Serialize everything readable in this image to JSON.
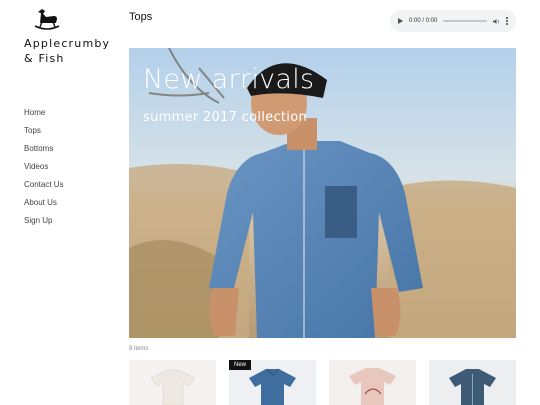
{
  "brand": {
    "name": "Applecrumby & Fish",
    "logo_icon": "rocking-horse-icon"
  },
  "nav": {
    "items": [
      {
        "label": "Home"
      },
      {
        "label": "Tops"
      },
      {
        "label": "Bottoms"
      },
      {
        "label": "Videos"
      },
      {
        "label": "Contact Us"
      },
      {
        "label": "About Us"
      },
      {
        "label": "Sign Up"
      }
    ]
  },
  "header": {
    "title": "Tops"
  },
  "audio": {
    "time": "0:00 / 0:00",
    "play_icon": "play-icon",
    "volume_icon": "volume-icon",
    "menu_icon": "more-vertical-icon"
  },
  "hero": {
    "title": "New arrivals",
    "subtitle": "summer 2017 collection"
  },
  "catalog": {
    "count_label": "8 items",
    "products": [
      {
        "badge": "",
        "shirt_color": "#f2efe9"
      },
      {
        "badge": "New",
        "shirt_color": "#3f6e9e"
      },
      {
        "badge": "",
        "shirt_color": "#e8c8bd"
      },
      {
        "badge": "",
        "shirt_color": "#3e5b75"
      }
    ]
  }
}
